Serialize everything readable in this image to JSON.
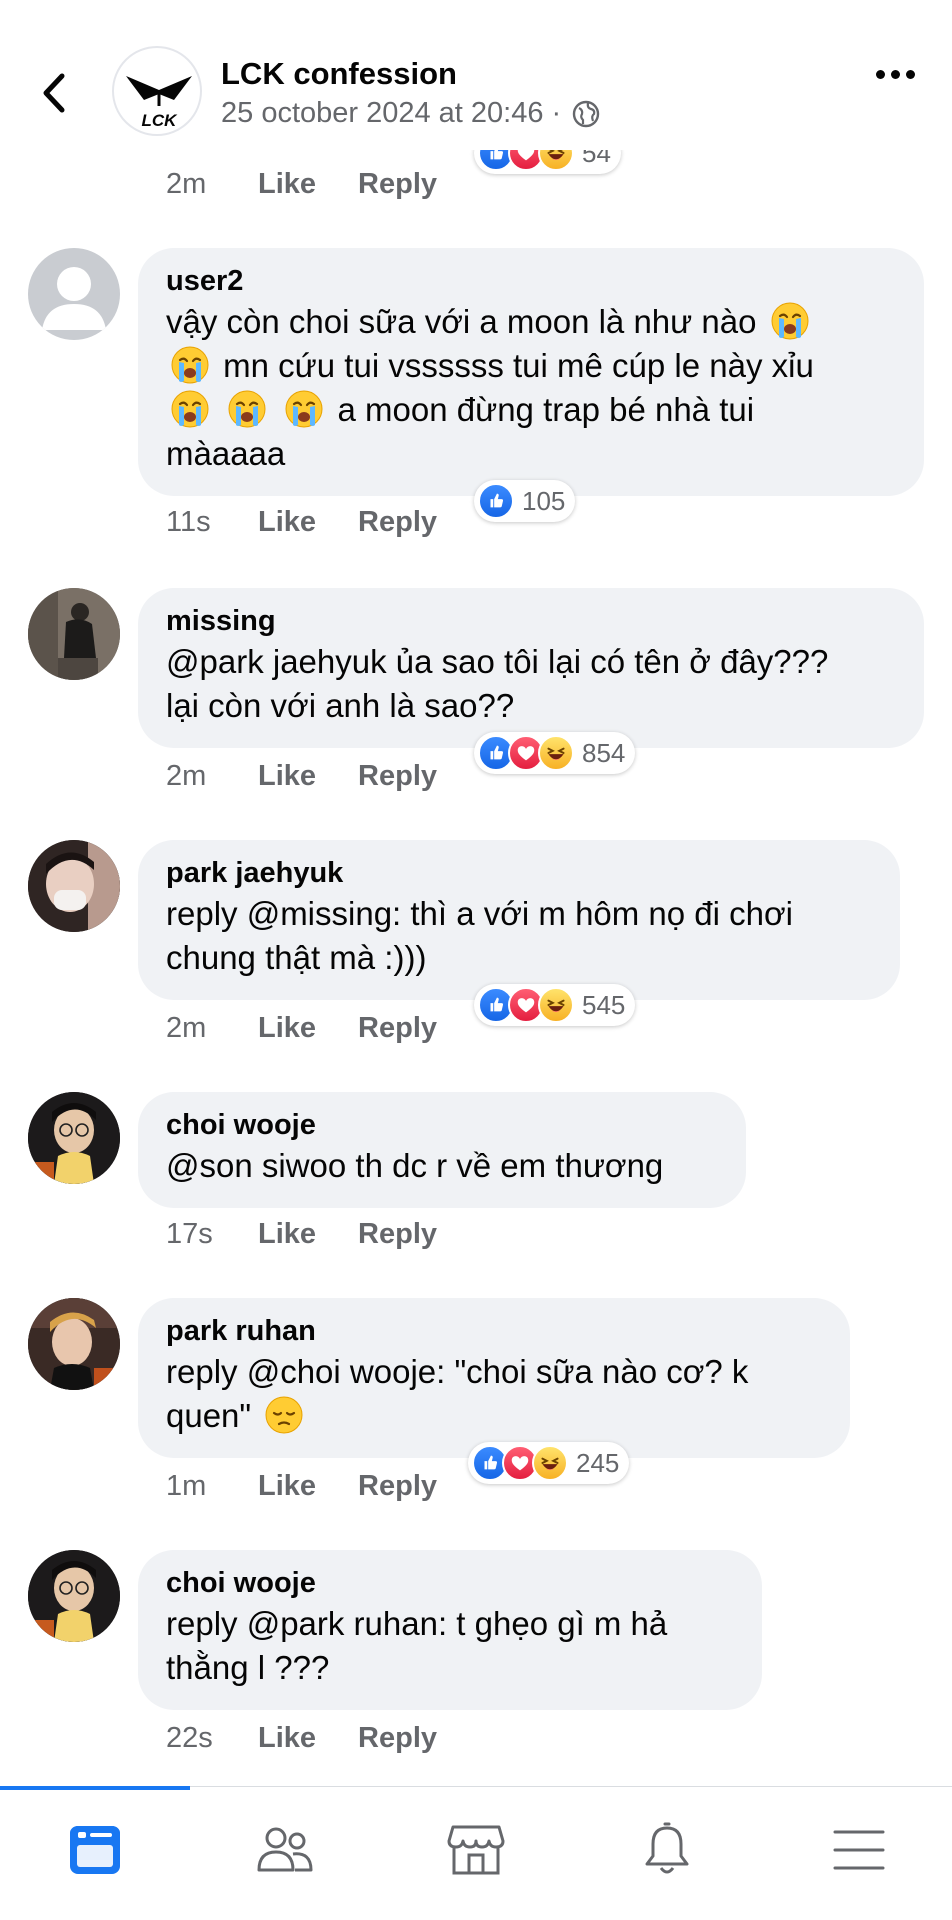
{
  "header": {
    "page_name": "LCK confession",
    "post_date": "25 october 2024 at 20:46 ·",
    "logo_text": "LCK"
  },
  "top_partial": {
    "time": "2m",
    "like": "Like",
    "reply": "Reply",
    "reaction_count": "54"
  },
  "comments": [
    {
      "author": "user2",
      "lines": [
        "vậy còn choi sữa với a moon là như nào",
        "mn cứu tui vssssss tui mê cúp le này xỉu",
        "a moon đừng trap bé nhà tui",
        "màaaaa"
      ],
      "time": "11s",
      "like": "Like",
      "reply": "Reply",
      "reaction_count": "105",
      "reactions": [
        "like"
      ]
    },
    {
      "author": "missing",
      "lines": [
        "@park jaehyuk ủa sao tôi lại có tên ở đây???",
        "lại còn với anh là sao??"
      ],
      "time": "2m",
      "like": "Like",
      "reply": "Reply",
      "reaction_count": "854",
      "reactions": [
        "like",
        "love",
        "haha"
      ]
    },
    {
      "author": "park jaehyuk",
      "lines": [
        "reply @missing: thì a với m hôm nọ đi chơi",
        "chung thật mà :)))"
      ],
      "time": "2m",
      "like": "Like",
      "reply": "Reply",
      "reaction_count": "545",
      "reactions": [
        "like",
        "love",
        "haha"
      ]
    },
    {
      "author": "choi wooje",
      "lines": [
        "@son siwoo th dc r về em thương"
      ],
      "time": "17s",
      "like": "Like",
      "reply": "Reply"
    },
    {
      "author": "park ruhan",
      "lines": [
        "reply @choi wooje: \"choi sữa nào cơ? k",
        "quen\""
      ],
      "time": "1m",
      "like": "Like",
      "reply": "Reply",
      "reaction_count": "245",
      "reactions": [
        "like",
        "love",
        "haha"
      ]
    },
    {
      "author": "choi wooje",
      "lines": [
        "reply @park ruhan: t ghẹo gì m hả",
        "thằng l ???"
      ],
      "time": "22s",
      "like": "Like",
      "reply": "Reply"
    }
  ],
  "tabbar": {
    "tabs": [
      {
        "icon": "feed-icon",
        "active": true
      },
      {
        "icon": "friends-icon",
        "active": false
      },
      {
        "icon": "marketplace-icon",
        "active": false
      },
      {
        "icon": "notifications-icon",
        "active": false
      },
      {
        "icon": "menu-icon",
        "active": false
      }
    ],
    "accent": "#1877f2"
  },
  "colors": {
    "bubble": "#f0f2f5",
    "secondary_text": "#65676b",
    "primary_text": "#050505"
  }
}
